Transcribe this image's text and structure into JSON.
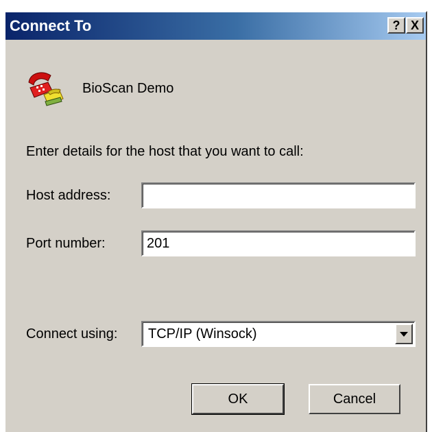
{
  "window": {
    "title": "Connect To",
    "help_label": "?",
    "close_label": "X"
  },
  "connection": {
    "name": "BioScan Demo",
    "icon": "telephone-connection-icon"
  },
  "instructions": "Enter details for the host that you want to call:",
  "host": {
    "label": "Host address:",
    "value": ""
  },
  "port": {
    "label": "Port number:",
    "value": "201"
  },
  "connect_using": {
    "label": "Connect using:",
    "value": "TCP/IP (Winsock)"
  },
  "buttons": {
    "ok": "OK",
    "cancel": "Cancel"
  },
  "colors": {
    "titlebar_start": "#0a246a",
    "titlebar_end": "#a6caf0",
    "dialog_face": "#d4d0c8"
  }
}
